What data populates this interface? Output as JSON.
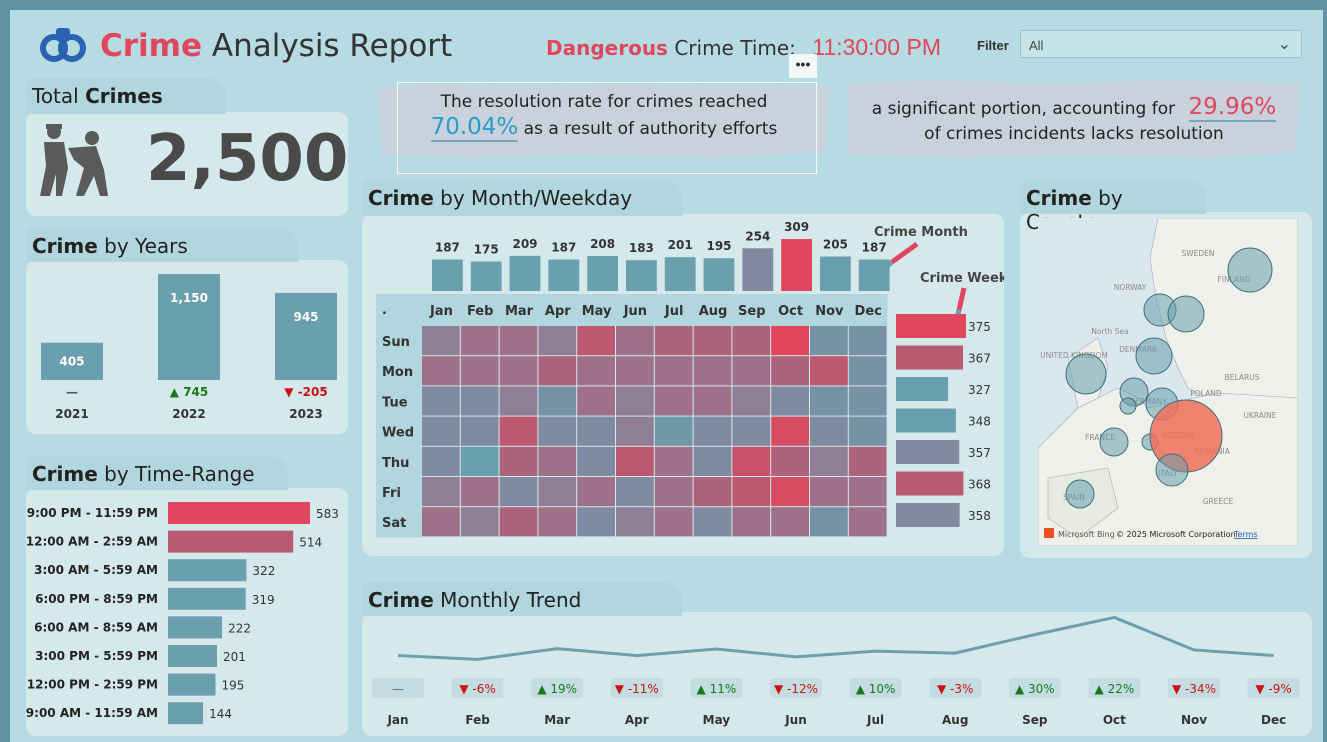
{
  "header": {
    "title_accent": "Crime",
    "title_rest": "Analysis Report",
    "danger_accent": "Dangerous",
    "danger_rest": "Crime Time:",
    "danger_time": "11:30:00 PM",
    "filter_label": "Filter",
    "filter_value": "All",
    "more_options": "•••"
  },
  "cards": {
    "total_label_plain": "Total",
    "total_label_bold": "Crimes",
    "total_value": "2,500",
    "resolution_line1": "The resolution rate for crimes reached",
    "resolution_pct": "70.04%",
    "resolution_line2": "as a result of authority efforts",
    "unresolved_line1": "a significant portion, accounting for",
    "unresolved_pct": "29.96%",
    "unresolved_line2": "of crimes incidents lacks resolution"
  },
  "sections": {
    "years_bold": "Crime",
    "years_rest": "by Years",
    "timerange_bold": "Crime",
    "timerange_rest": "by Time-Range",
    "monthweek_bold": "Crime",
    "monthweek_rest": "by Month/Weekday",
    "country_bold": "Crime",
    "country_rest": "by Country",
    "trend_bold": "Crime",
    "trend_rest": "Monthly Trend"
  },
  "colors": {
    "teal": "#6a9fad",
    "red": "#e0465d",
    "rose": "#b85a72",
    "slate": "#838aa0",
    "green": "#1a7a1a",
    "negative": "#cc1111"
  },
  "chart_data": [
    {
      "type": "bar",
      "name": "years",
      "categories": [
        "2021",
        "2022",
        "2023"
      ],
      "values": [
        405,
        1150,
        945
      ],
      "value_labels": [
        "405",
        "1,150",
        "945"
      ],
      "changes": [
        {
          "icon": "dash",
          "text": "—"
        },
        {
          "icon": "up",
          "text": "▲ 745"
        },
        {
          "icon": "down",
          "text": "▼ -205"
        }
      ]
    },
    {
      "type": "bar",
      "name": "time_range",
      "orientation": "horizontal",
      "categories": [
        "9:00 PM - 11:59 PM",
        "12:00 AM - 2:59 AM",
        "3:00 AM - 5:59 AM",
        "6:00 PM - 8:59 PM",
        "6:00 AM - 8:59 AM",
        "3:00 PM - 5:59 PM",
        "12:00 PM - 2:59 PM",
        "9:00 AM - 11:59 AM"
      ],
      "values": [
        583,
        514,
        322,
        319,
        222,
        201,
        195,
        144
      ]
    },
    {
      "type": "bar",
      "name": "crime_month",
      "label": "Crime Month",
      "categories": [
        "Jan",
        "Feb",
        "Mar",
        "Apr",
        "May",
        "Jun",
        "Jul",
        "Aug",
        "Sep",
        "Oct",
        "Nov",
        "Dec"
      ],
      "values": [
        187,
        175,
        209,
        187,
        208,
        183,
        201,
        195,
        254,
        309,
        205,
        187
      ]
    },
    {
      "type": "bar",
      "name": "crime_week",
      "label": "Crime Week",
      "orientation": "horizontal",
      "categories": [
        "Sun",
        "Mon",
        "Tue",
        "Wed",
        "Thu",
        "Fri",
        "Sat"
      ],
      "values": [
        375,
        367,
        327,
        348,
        357,
        368,
        358
      ]
    },
    {
      "type": "heatmap",
      "name": "month_weekday",
      "corner": ".",
      "columns": [
        "Jan",
        "Feb",
        "Mar",
        "Apr",
        "May",
        "Jun",
        "Jul",
        "Aug",
        "Sep",
        "Oct",
        "Nov",
        "Dec"
      ],
      "rows": [
        "Sun",
        "Mon",
        "Tue",
        "Wed",
        "Thu",
        "Fri",
        "Sat"
      ],
      "levels": [
        [
          0.4,
          0.5,
          0.5,
          0.4,
          0.7,
          0.5,
          0.6,
          0.6,
          0.6,
          1.0,
          0.2,
          0.2
        ],
        [
          0.5,
          0.5,
          0.5,
          0.6,
          0.5,
          0.5,
          0.5,
          0.5,
          0.5,
          0.6,
          0.7,
          0.2
        ],
        [
          0.3,
          0.3,
          0.4,
          0.2,
          0.5,
          0.4,
          0.5,
          0.5,
          0.4,
          0.3,
          0.2,
          0.2
        ],
        [
          0.3,
          0.3,
          0.7,
          0.3,
          0.3,
          0.4,
          0.1,
          0.3,
          0.3,
          0.9,
          0.3,
          0.2
        ],
        [
          0.3,
          0.0,
          0.6,
          0.5,
          0.3,
          0.7,
          0.5,
          0.3,
          0.8,
          0.6,
          0.4,
          0.6
        ],
        [
          0.4,
          0.5,
          0.3,
          0.4,
          0.5,
          0.3,
          0.5,
          0.6,
          0.7,
          0.9,
          0.5,
          0.5
        ],
        [
          0.5,
          0.4,
          0.6,
          0.5,
          0.3,
          0.4,
          0.5,
          0.3,
          0.5,
          0.5,
          0.2,
          0.5
        ]
      ]
    },
    {
      "type": "line",
      "name": "monthly_trend",
      "categories": [
        "Jan",
        "Feb",
        "Mar",
        "Apr",
        "May",
        "Jun",
        "Jul",
        "Aug",
        "Sep",
        "Oct",
        "Nov",
        "Dec"
      ],
      "values": [
        187,
        175,
        209,
        187,
        208,
        183,
        201,
        195,
        254,
        309,
        205,
        187
      ],
      "changes": [
        "—",
        "▼ -6%",
        "▲ 19%",
        "▼ -11%",
        "▲ 11%",
        "▼ -12%",
        "▲ 10%",
        "▼ -3%",
        "▲ 30%",
        "▲ 22%",
        "▼ -34%",
        "▼ -9%"
      ],
      "change_dirs": [
        "none",
        "down",
        "up",
        "down",
        "up",
        "down",
        "up",
        "down",
        "up",
        "up",
        "down",
        "down"
      ]
    }
  ],
  "map": {
    "labels": [
      "North Sea",
      "NORWAY",
      "SWEDEN",
      "FINLAND",
      "DENMARK",
      "UNITED KINGDOM",
      "GERMANY",
      "POLAND",
      "BELARUS",
      "UKRAINE",
      "FRANCE",
      "AUSTRIA",
      "ROMANIA",
      "ITALY",
      "SPAIN",
      "GREECE"
    ],
    "bing": "Microsoft Bing",
    "copyright": "© 2025 Microsoft Corporation",
    "terms": "Terms"
  },
  "icons": [
    "handcuffs-icon",
    "arrest-icon",
    "chevron-down-icon",
    "arrow-down-icon"
  ]
}
